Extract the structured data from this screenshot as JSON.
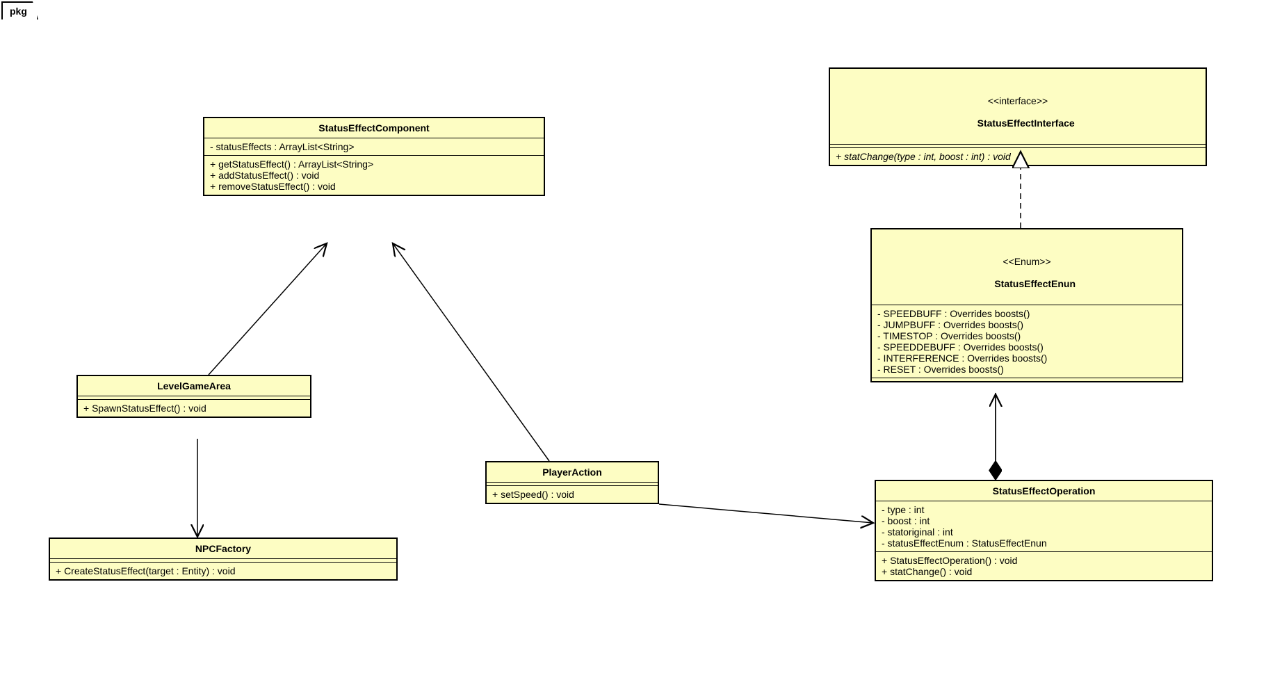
{
  "pkg_label": "pkg",
  "classes": {
    "statusEffectComponent": {
      "name": "StatusEffectComponent",
      "attrs": "- statusEffects : ArrayList<String>",
      "ops": "+ getStatusEffect() : ArrayList<String>\n+ addStatusEffect() : void\n+ removeStatusEffect() : void"
    },
    "levelGameArea": {
      "name": "LevelGameArea",
      "ops": "+ SpawnStatusEffect() : void"
    },
    "npcFactory": {
      "name": "NPCFactory",
      "ops": "+ CreateStatusEffect(target : Entity) : void"
    },
    "playerAction": {
      "name": "PlayerAction",
      "ops": "+ setSpeed() : void"
    },
    "statusEffectInterface": {
      "stereo": "<<interface>>",
      "name": "StatusEffectInterface",
      "ops": "+ statChange(type : int, boost : int) : void"
    },
    "statusEffectEnun": {
      "stereo": "<<Enum>>",
      "name": "StatusEffectEnun",
      "attrs": "- SPEEDBUFF : Overrides boosts()\n- JUMPBUFF : Overrides boosts()\n- TIMESTOP : Overrides boosts()\n- SPEEDDEBUFF : Overrides boosts()\n- INTERFERENCE : Overrides boosts()\n- RESET : Overrides boosts()"
    },
    "statusEffectOperation": {
      "name": "StatusEffectOperation",
      "attrs": "- type : int\n- boost : int\n- statoriginal : int\n- statusEffectEnum : StatusEffectEnun",
      "ops": "+ StatusEffectOperation() : void\n+ statChange() : void"
    }
  }
}
